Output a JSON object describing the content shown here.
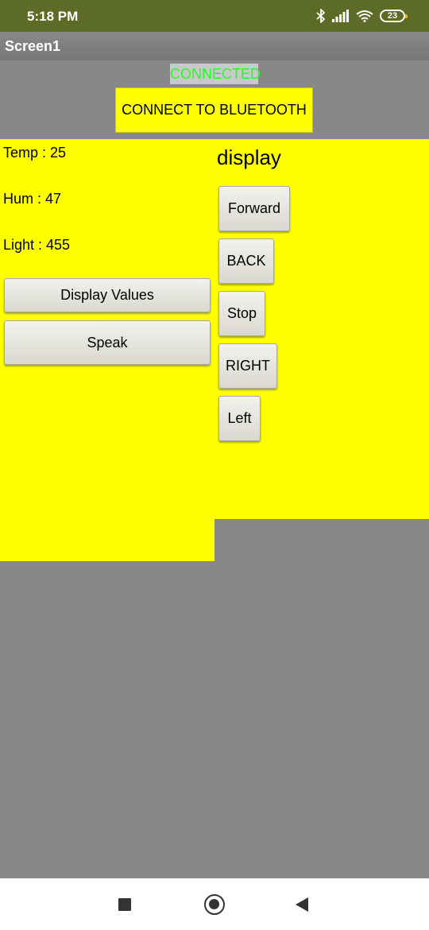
{
  "status_bar": {
    "time": "5:18 PM",
    "battery_level": "23",
    "icons": [
      "bluetooth-icon",
      "signal-icon",
      "wifi-icon",
      "battery-icon"
    ]
  },
  "title_bar": {
    "title": "Screen1"
  },
  "connection": {
    "status": "CONNECTED",
    "connect_button": "CONNECT TO BLUETOOTH"
  },
  "sensors": {
    "temp": "Temp : 25",
    "hum": "Hum : 47",
    "light": "Light : 455"
  },
  "actions": {
    "display_values": "Display Values",
    "speak": "Speak"
  },
  "controls": {
    "heading": "display",
    "forward": "Forward",
    "back": "BACK",
    "stop": "Stop",
    "right": "RIGHT",
    "left": "Left"
  },
  "nav_bar": {
    "icons": [
      "recents-square-icon",
      "home-circle-icon",
      "back-triangle-icon"
    ]
  },
  "colors": {
    "status_bar_bg": "#5c6b25",
    "panel_yellow": "#ffff00",
    "screen_bg": "#888888",
    "connected_text": "#22ff22"
  }
}
